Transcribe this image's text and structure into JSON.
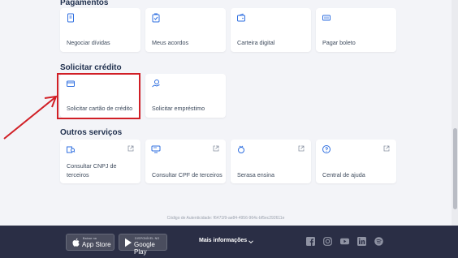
{
  "sections": {
    "pagamentos": "Pagamentos",
    "solicitar_credito": "Solicitar crédito",
    "outros_servicos": "Outros serviços"
  },
  "pagamentos": [
    {
      "label": "Negociar dívidas",
      "icon": "document-list-icon"
    },
    {
      "label": "Meus acordos",
      "icon": "agreement-icon"
    },
    {
      "label": "Carteira digital",
      "icon": "wallet-icon"
    },
    {
      "label": "Pagar boleto",
      "icon": "barcode-icon"
    }
  ],
  "credito": [
    {
      "label": "Solicitar cartão de crédito",
      "icon": "credit-card-icon"
    },
    {
      "label": "Solicitar empréstimo",
      "icon": "loan-icon"
    }
  ],
  "outros": [
    {
      "label1": "Consultar CNPJ de",
      "label2": "terceiros",
      "icon": "company-search-icon"
    },
    {
      "label1": "Consultar CPF de terceiros",
      "label2": "",
      "icon": "person-search-icon"
    },
    {
      "label1": "Serasa ensina",
      "label2": "",
      "icon": "education-icon"
    },
    {
      "label1": "Central de ajuda",
      "label2": "",
      "icon": "help-icon"
    }
  ],
  "auth_code": "Código de Autenticidade: f6471f9-ae84-4956-964c-bf5ec292611e",
  "footer": {
    "app_store_small": "Baixar na",
    "app_store_big": "App Store",
    "google_play_small": "DISPONÍVEL NO",
    "google_play_big": "Google Play",
    "more_info": "Mais informações"
  },
  "colors": {
    "accent": "#2f6fe0",
    "highlight": "#d11f26",
    "footer_bg": "#2a2e45"
  }
}
